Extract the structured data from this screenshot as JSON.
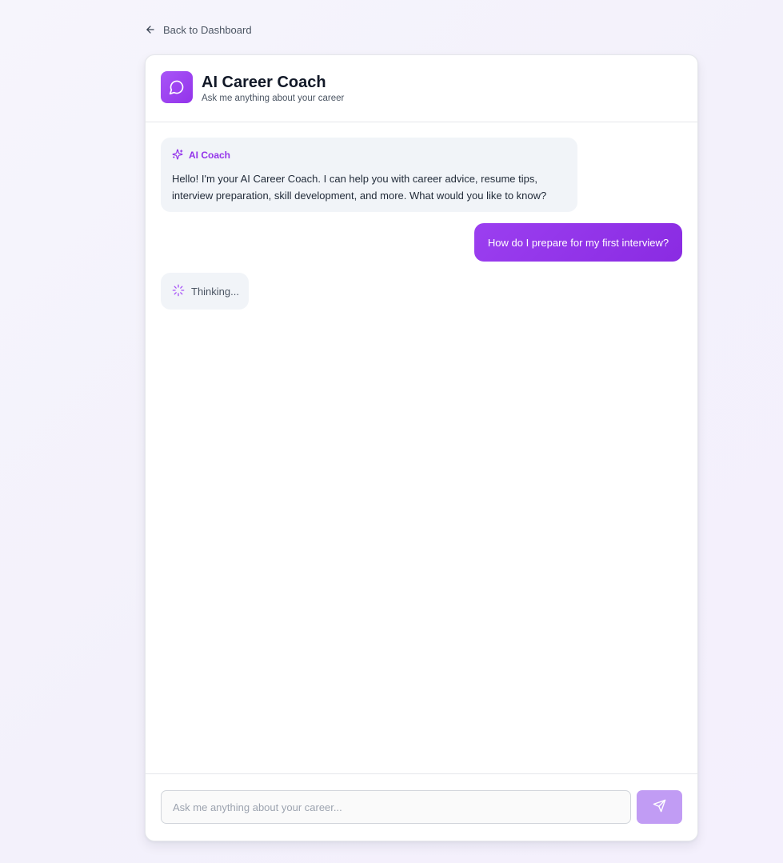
{
  "nav": {
    "back_label": "Back to Dashboard",
    "back_icon": "arrow-left-icon"
  },
  "header": {
    "icon": "chat-bubble-icon",
    "title": "AI Career Coach",
    "subtitle": "Ask me anything about your career"
  },
  "messages": {
    "ai_greeting": {
      "sender_label": "AI Coach",
      "sender_icon": "sparkles-icon",
      "text": "Hello! I'm your AI Career Coach. I can help you with career advice, resume tips, interview preparation, skill development, and more. What would you like to know?"
    },
    "user_question": {
      "text": "How do I prepare for my first interview?"
    },
    "thinking": {
      "icon": "spinner-icon",
      "text": "Thinking..."
    }
  },
  "composer": {
    "input_value": "",
    "placeholder": "Ask me anything about your career...",
    "send_icon": "send-icon"
  },
  "colors": {
    "accent": "#9333ea",
    "accent_light": "#c19cf4",
    "bubble_ai_bg": "#f1f4f8"
  }
}
